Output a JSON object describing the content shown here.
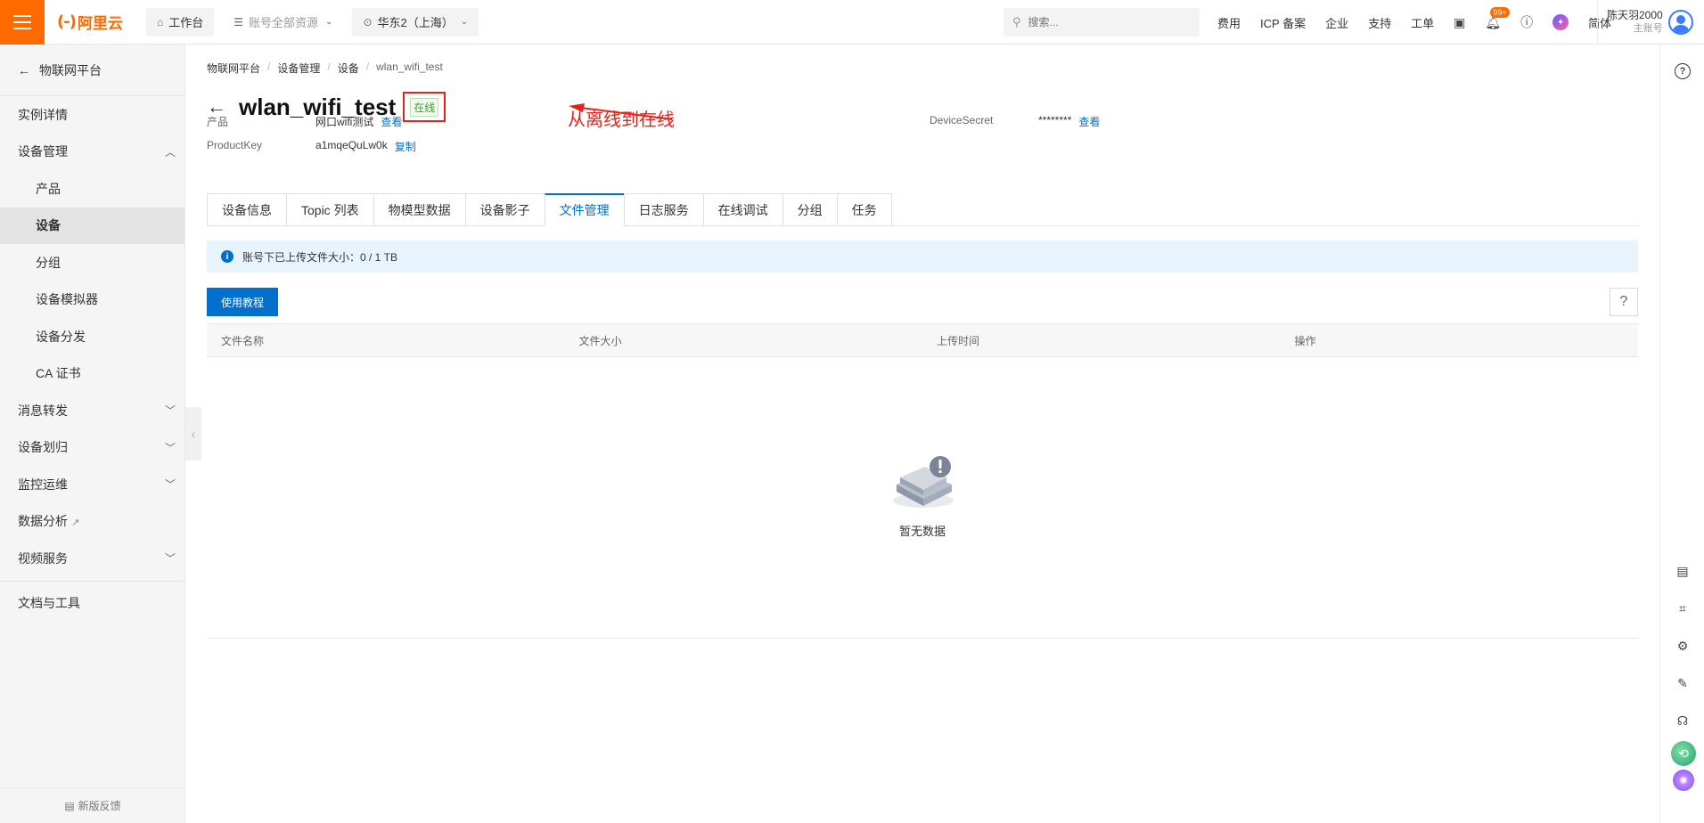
{
  "topbar": {
    "logo_text": "阿里云",
    "workbench": "工作台",
    "all_resources": "账号全部资源",
    "region": "华东2（上海）",
    "search_placeholder": "搜索...",
    "links": [
      "费用",
      "ICP 备案",
      "企业",
      "支持",
      "工单"
    ],
    "notification_badge": "99+",
    "language": "简体",
    "user_name": "陈天羽2000",
    "user_role": "主账号"
  },
  "sidebar": {
    "back_label": "物联网平台",
    "items": [
      {
        "label": "实例详情",
        "level": 1,
        "expand": ""
      },
      {
        "label": "设备管理",
        "level": 1,
        "expand": "up"
      },
      {
        "label": "产品",
        "level": 2
      },
      {
        "label": "设备",
        "level": 2,
        "active": true
      },
      {
        "label": "分组",
        "level": 2
      },
      {
        "label": "设备模拟器",
        "level": 2
      },
      {
        "label": "设备分发",
        "level": 2
      },
      {
        "label": "CA 证书",
        "level": 2
      },
      {
        "label": "消息转发",
        "level": 1,
        "expand": "down"
      },
      {
        "label": "设备划归",
        "level": 1,
        "expand": "down"
      },
      {
        "label": "监控运维",
        "level": 1,
        "expand": "down"
      },
      {
        "label": "数据分析",
        "level": 1,
        "external": true
      },
      {
        "label": "视频服务",
        "level": 1,
        "expand": "down"
      }
    ],
    "docs_tools": "文档与工具",
    "feedback": "新版反馈"
  },
  "breadcrumb": [
    "物联网平台",
    "设备管理",
    "设备",
    "wlan_wifi_test"
  ],
  "device": {
    "name": "wlan_wifi_test",
    "status": "在线",
    "annotation": "从离线到在线",
    "product_label": "产品",
    "product_value": "网口wifi测试",
    "product_link": "查看",
    "productkey_label": "ProductKey",
    "productkey_value": "a1mqeQuLw0k",
    "productkey_link": "复制",
    "secret_label": "DeviceSecret",
    "secret_value": "********",
    "secret_link": "查看"
  },
  "tabs": [
    "设备信息",
    "Topic 列表",
    "物模型数据",
    "设备影子",
    "文件管理",
    "日志服务",
    "在线调试",
    "分组",
    "任务"
  ],
  "active_tab": "文件管理",
  "notice": "账号下已上传文件大小：0 / 1 TB",
  "tutorial_button": "使用教程",
  "table": {
    "columns": [
      "文件名称",
      "文件大小",
      "上传时间",
      "操作"
    ],
    "rows": [],
    "empty_text": "暂无数据"
  },
  "colors": {
    "brand": "#ff6a00",
    "primary": "#0070cc",
    "annotation": "#e5231b",
    "online": "#3a9b2c"
  }
}
